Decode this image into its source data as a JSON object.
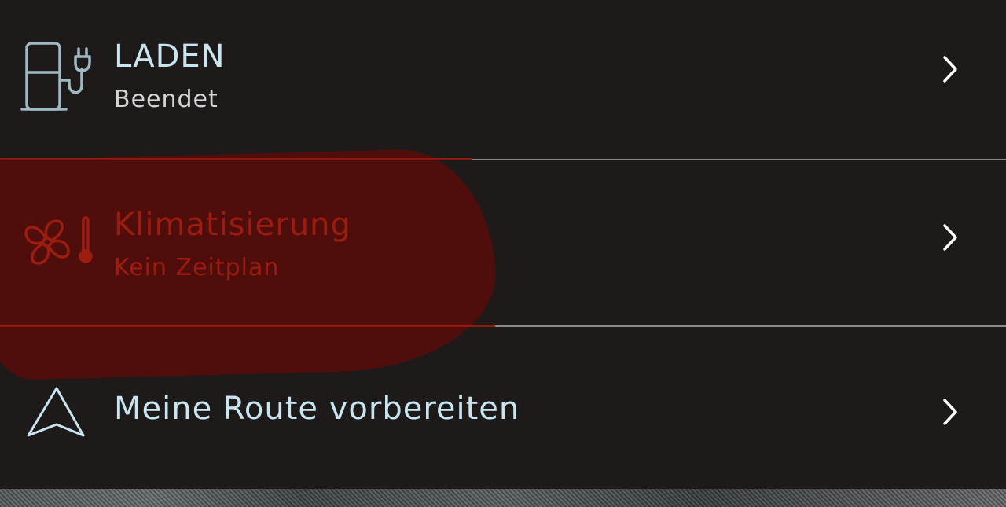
{
  "menu": {
    "items": [
      {
        "icon": "charging-station-icon",
        "title": "LADEN",
        "subtitle": "Beendet"
      },
      {
        "icon": "fan-thermometer-icon",
        "title": "Klimatisierung",
        "subtitle": "Kein Zeitplan"
      },
      {
        "icon": "navigation-arrow-icon",
        "title": "Meine Route vorbereiten"
      }
    ]
  },
  "colors": {
    "background": "#1e1a1a",
    "text_primary": "#c9e6f0",
    "text_secondary": "#d6d6d6",
    "highlight_text": "#c83a22",
    "highlight_overlay": "#780500",
    "divider": "#8e8a8a"
  }
}
